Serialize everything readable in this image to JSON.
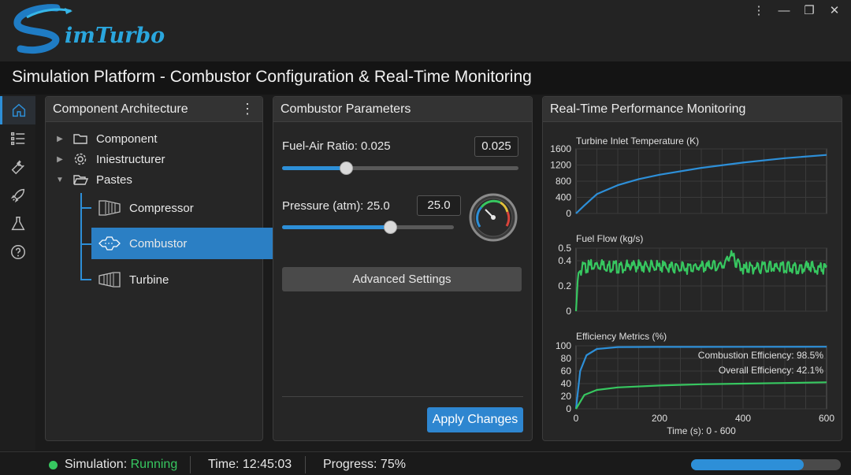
{
  "app": {
    "logo_text": "imTurbo",
    "page_title": "Simulation Platform - Combustor Configuration & Real-Time Monitoring",
    "window_controls": [
      "more-vert-icon",
      "minimize-icon",
      "restore-icon",
      "close-icon"
    ]
  },
  "rail": {
    "items": [
      "home-icon",
      "list-icon",
      "wrench-icon",
      "rocket-icon",
      "flask-icon",
      "help-icon"
    ],
    "active": "home-icon"
  },
  "architecture": {
    "title": "Component Architecture",
    "tree": [
      {
        "label": "Component",
        "icon": "folder-icon",
        "expanded": false
      },
      {
        "label": "Iniestructurer",
        "icon": "gear-icon",
        "expanded": false
      },
      {
        "label": "Pastes",
        "icon": "folder-open-icon",
        "expanded": true
      }
    ],
    "children": [
      {
        "label": "Compressor",
        "icon": "compressor-icon",
        "selected": false
      },
      {
        "label": "Combustor",
        "icon": "combustor-icon",
        "selected": true
      },
      {
        "label": "Turbine",
        "icon": "turbine-icon",
        "selected": false
      }
    ]
  },
  "params": {
    "title": "Combustor Parameters",
    "fuel_air": {
      "label": "Fuel-Air Ratio: 0.025",
      "value": "0.025",
      "fraction": 0.27
    },
    "pressure": {
      "label": "Pressure (atm): 25.0",
      "value": "25.0",
      "fraction": 0.63
    },
    "advanced_label": "Advanced Settings",
    "apply_label": "Apply Changes"
  },
  "monitor": {
    "title": "Real-Time Performance Monitoring",
    "colors": {
      "blue": "#2d8fd8",
      "green": "#37c760",
      "grid": "#3a3a3a"
    },
    "x_axis_label": "Time (s): 0 - 600",
    "x_ticks": [
      "0",
      "200",
      "400",
      "600"
    ],
    "tit": {
      "title": "Turbine Inlet Temperature (K)",
      "y_ticks": [
        "1600",
        "1200",
        "800",
        "400",
        "0"
      ]
    },
    "fuel": {
      "title": "Fuel Flow (kg/s)",
      "y_ticks": [
        "0.5",
        "0.4",
        "0.2",
        "0"
      ]
    },
    "eff": {
      "title": "Efficiency Metrics (%)",
      "y_ticks": [
        "100",
        "80",
        "60",
        "40",
        "20",
        "0"
      ],
      "legend_combustion": "Combustion Efficiency: 98.5%",
      "legend_overall": "Overall Efficiency: 42.1%"
    }
  },
  "chart_data": [
    {
      "type": "line",
      "title": "Turbine Inlet Temperature (K)",
      "xlabel": "Time (s): 0 - 600",
      "ylabel": "",
      "xlim": [
        0,
        600
      ],
      "ylim": [
        0,
        1600
      ],
      "series": [
        {
          "values": [
            [
              0,
              0
            ],
            [
              20,
              200
            ],
            [
              50,
              480
            ],
            [
              100,
              700
            ],
            [
              150,
              850
            ],
            [
              200,
              960
            ],
            [
              300,
              1130
            ],
            [
              400,
              1260
            ],
            [
              500,
              1370
            ],
            [
              600,
              1450
            ]
          ]
        }
      ]
    },
    {
      "type": "line",
      "title": "Fuel Flow (kg/s)",
      "xlabel": "Time (s): 0 - 600",
      "ylabel": "",
      "xlim": [
        0,
        600
      ],
      "ylim": [
        0,
        0.5
      ],
      "series": [
        {
          "values": [
            [
              0,
              0
            ],
            [
              5,
              0.3
            ],
            [
              15,
              0.34
            ],
            [
              50,
              0.37
            ],
            [
              100,
              0.35
            ],
            [
              150,
              0.36
            ],
            [
              200,
              0.35
            ],
            [
              250,
              0.34
            ],
            [
              300,
              0.35
            ],
            [
              350,
              0.36
            ],
            [
              370,
              0.44
            ],
            [
              400,
              0.34
            ],
            [
              450,
              0.35
            ],
            [
              500,
              0.34
            ],
            [
              550,
              0.35
            ],
            [
              600,
              0.33
            ]
          ]
        }
      ]
    },
    {
      "type": "line",
      "title": "Efficiency Metrics (%)",
      "xlabel": "Time (s): 0 - 600",
      "ylabel": "",
      "xlim": [
        0,
        600
      ],
      "ylim": [
        0,
        100
      ],
      "series": [
        {
          "name": "Combustion Efficiency: 98.5%",
          "values": [
            [
              0,
              0
            ],
            [
              10,
              60
            ],
            [
              25,
              85
            ],
            [
              50,
              95
            ],
            [
              100,
              98
            ],
            [
              200,
              98.2
            ],
            [
              400,
              98.4
            ],
            [
              600,
              98.5
            ]
          ]
        },
        {
          "name": "Overall Efficiency: 42.1%",
          "values": [
            [
              0,
              0
            ],
            [
              20,
              22
            ],
            [
              50,
              30
            ],
            [
              100,
              34
            ],
            [
              200,
              37
            ],
            [
              300,
              39
            ],
            [
              400,
              40
            ],
            [
              500,
              41
            ],
            [
              600,
              42.1
            ]
          ]
        }
      ]
    }
  ],
  "status": {
    "sim_label": "Simulation:",
    "sim_state": "Running",
    "time": "Time: 12:45:03",
    "progress_label": "Progress: 75%",
    "progress_fraction": 0.75
  }
}
